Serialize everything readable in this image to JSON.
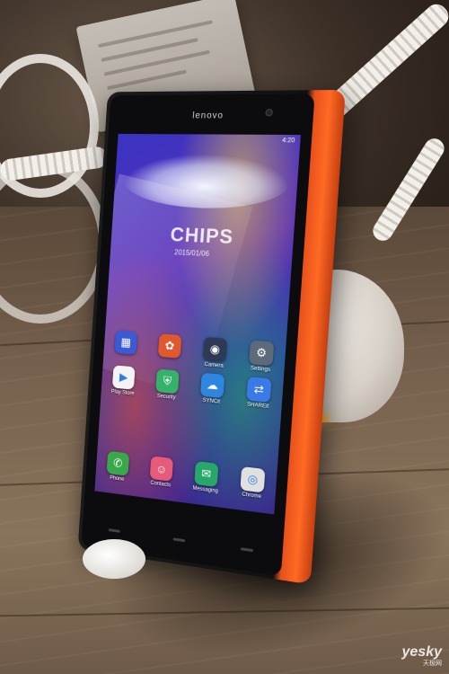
{
  "phone": {
    "brand": "lenovo",
    "status_bar": "4:20",
    "clock": "CHIPS",
    "date": "2015/01/06"
  },
  "apps": [
    {
      "label": "",
      "icon": "folder-icon",
      "color": "#3b5bd6"
    },
    {
      "label": "",
      "icon": "gallery-icon",
      "color": "#e0582b"
    },
    {
      "label": "Camera",
      "icon": "camera-icon",
      "color": "#2e3a55"
    },
    {
      "label": "Settings",
      "icon": "gear-icon",
      "color": "#5e6a7a"
    },
    {
      "label": "Play Store",
      "icon": "play-store-icon",
      "color": "#f3f3f3"
    },
    {
      "label": "Security",
      "icon": "shield-icon",
      "color": "#35b26a"
    },
    {
      "label": "SYNCit",
      "icon": "cloud-icon",
      "color": "#2f86e0"
    },
    {
      "label": "SHAREit",
      "icon": "share-icon",
      "color": "#3a7ae6"
    }
  ],
  "dock": [
    {
      "label": "Phone",
      "icon": "phone-icon",
      "color": "#39a84a"
    },
    {
      "label": "Contacts",
      "icon": "contacts-icon",
      "color": "#e65a7a"
    },
    {
      "label": "Messaging",
      "icon": "messaging-icon",
      "color": "#27a86a"
    },
    {
      "label": "Chrome",
      "icon": "chrome-icon",
      "color": "#e0e0e0"
    }
  ],
  "watermark": {
    "main": "yesky",
    "sub": "天极网"
  }
}
